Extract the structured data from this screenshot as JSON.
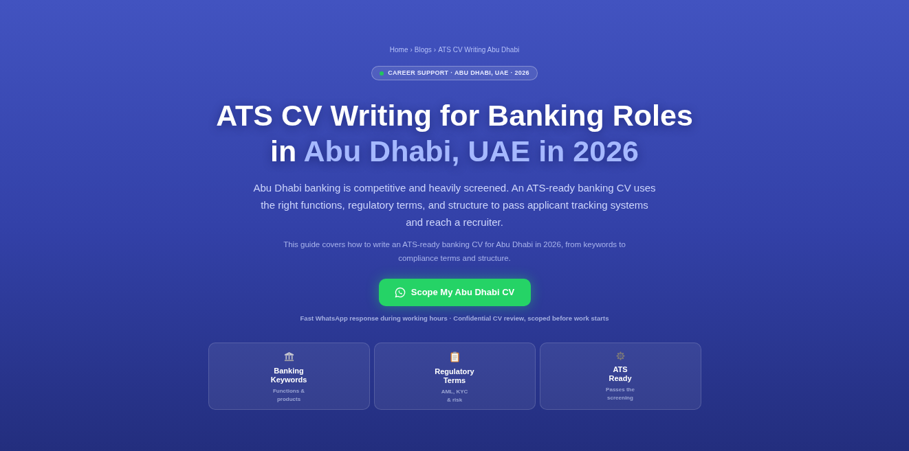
{
  "breadcrumb": {
    "items": [
      "Home",
      "Blogs",
      "ATS CV Writing Abu Dhabi"
    ],
    "separator": "›"
  },
  "badge": {
    "text": "CAREER SUPPORT · ABU DHABI, UAE · 2026"
  },
  "title": {
    "lead": "ATS CV Writing for Banking Roles in",
    "highlight": "Abu Dhabi, UAE in 2026"
  },
  "intro": "Abu Dhabi banking is competitive and heavily screened. An ATS-ready banking CV uses the right functions, regulatory terms, and structure to pass applicant tracking systems and reach a recruiter.",
  "summary": "This guide covers how to write an ATS-ready banking CV for Abu Dhabi in 2026, from keywords to compliance terms and structure.",
  "cta": {
    "label": "Scope My Abu Dhabi CV",
    "note": "Fast WhatsApp response during working hours · Confidential CV review, scoped before work starts"
  },
  "features": [
    {
      "title": "Banking\nKeywords",
      "detail": "Functions &\nproducts"
    },
    {
      "title": "Regulatory\nTerms",
      "detail": "AML, KYC\n& risk"
    },
    {
      "title": "ATS\nReady",
      "detail": "Passes the\nscreening"
    }
  ]
}
